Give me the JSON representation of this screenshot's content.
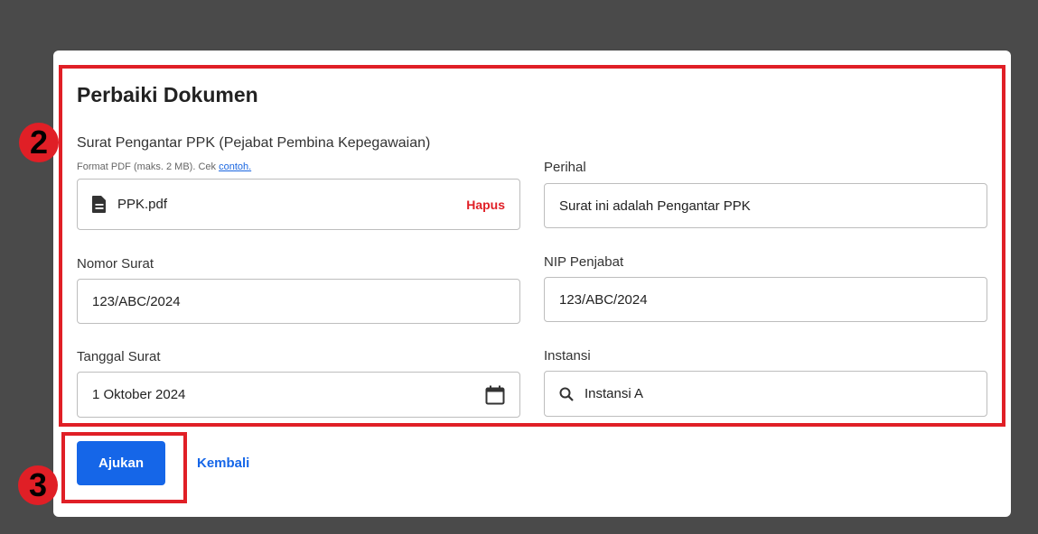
{
  "form": {
    "title": "Perbaiki Dokumen",
    "upload": {
      "label": "Surat Pengantar PPK (Pejabat Pembina Kepegawaian)",
      "hint_text": "Format PDF (maks. 2 MB). Cek ",
      "hint_link": "contoh.",
      "file_name": "PPK.pdf",
      "remove_label": "Hapus",
      "file_icon": "file-icon"
    },
    "perihal": {
      "label": "Perihal",
      "value": "Surat ini adalah Pengantar PPK"
    },
    "nomor_surat": {
      "label": "Nomor Surat",
      "value": "123/ABC/2024"
    },
    "nip_penjabat": {
      "label": "NIP Penjabat",
      "value": "123/ABC/2024"
    },
    "tanggal_surat": {
      "label": "Tanggal Surat",
      "value": "1 Oktober 2024",
      "icon": "calendar-icon"
    },
    "instansi": {
      "label": "Instansi",
      "value": "Instansi A",
      "icon": "search-icon"
    }
  },
  "actions": {
    "submit_label": "Ajukan",
    "back_label": "Kembali"
  },
  "annotations": {
    "step_form": "2",
    "step_submit": "3"
  },
  "colors": {
    "accent": "#1566e8",
    "danger": "#e01f26",
    "backdrop": "#4a4a4a"
  }
}
